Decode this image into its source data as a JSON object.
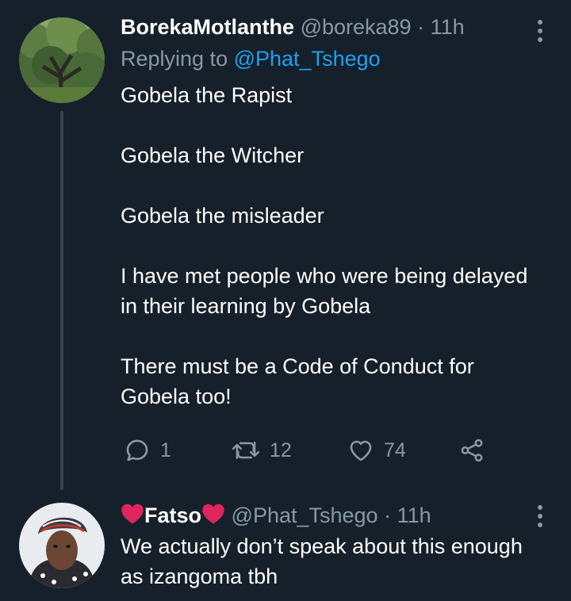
{
  "tweets": [
    {
      "display_name": "BorekaMotlanthe",
      "handle": "@boreka89",
      "separator": "·",
      "time": "11h",
      "replying_label": "Replying to",
      "replying_handle": "@Phat_Tshego",
      "body": [
        "Gobela the Rapist",
        "Gobela the Witcher",
        "Gobela the misleader",
        "I have met people who were being delayed in their learning by Gobela",
        "There must be a Code of Conduct for Gobela too!"
      ],
      "counts": {
        "replies": "1",
        "retweets": "12",
        "likes": "74"
      },
      "avatar_icon": "tree-photo"
    },
    {
      "display_name": "Fatso",
      "name_emoji": "red-heart",
      "handle": "@Phat_Tshego",
      "separator": "·",
      "time": "11h",
      "body": [
        "We actually don’t speak about this enough as izangoma tbh"
      ],
      "avatar_icon": "woman-headwrap-photo"
    }
  ],
  "colors": {
    "background": "#15202b",
    "secondary_text": "#8899a6",
    "link": "#1da1f2",
    "thread_line": "#38444d",
    "heart": "#e0245e"
  }
}
